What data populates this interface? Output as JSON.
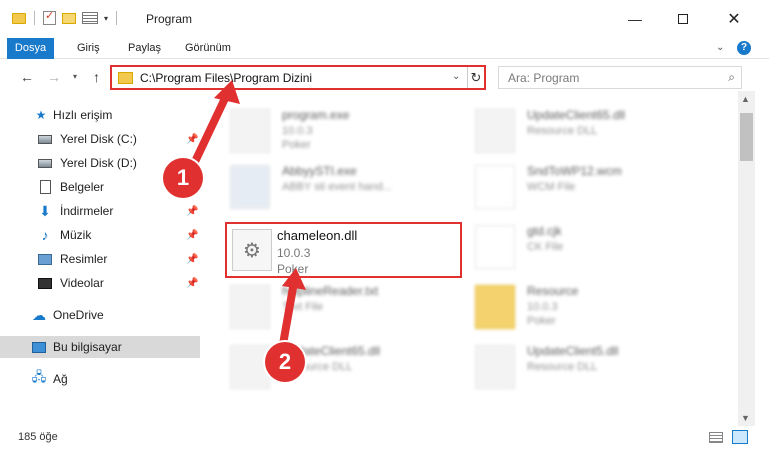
{
  "window": {
    "title": "Program",
    "minimize_glyph": "—",
    "close_glyph": "✕"
  },
  "ribbon": {
    "tabs": [
      {
        "label": "Dosya"
      },
      {
        "label": "Giriş"
      },
      {
        "label": "Paylaş"
      },
      {
        "label": "Görünüm"
      }
    ],
    "help_label": "?"
  },
  "navigation": {
    "address": "C:\\Program Files\\Program Dizini",
    "search_placeholder": "Ara: Program"
  },
  "sidebar": {
    "items": [
      {
        "label": "Hızlı erişim",
        "icon": "star-icon"
      },
      {
        "label": "Yerel Disk (C:)",
        "icon": "drive-icon",
        "pinned": true
      },
      {
        "label": "Yerel Disk (D:)",
        "icon": "drive-icon"
      },
      {
        "label": "Belgeler",
        "icon": "documents-icon",
        "pinned": true
      },
      {
        "label": "İndirmeler",
        "icon": "downloads-icon",
        "pinned": true
      },
      {
        "label": "Müzik",
        "icon": "music-icon",
        "pinned": true
      },
      {
        "label": "Resimler",
        "icon": "pictures-icon",
        "pinned": true
      },
      {
        "label": "Videolar",
        "icon": "videos-icon",
        "pinned": true
      },
      {
        "label": "OneDrive",
        "icon": "cloud-icon"
      },
      {
        "label": "Bu bilgisayar",
        "icon": "computer-icon",
        "selected": true
      },
      {
        "label": "Ağ",
        "icon": "network-icon"
      }
    ]
  },
  "files": {
    "left": [
      {
        "name": "program.exe",
        "line1": "10.0.3",
        "line2": "Poker"
      },
      {
        "name": "AbbyySTI.exe",
        "line1": "ABBY sti event hand...",
        "line2": ""
      },
      {
        "name": "chameleon.dll",
        "line1": "10.0.3",
        "line2": "Poker"
      },
      {
        "name": "helplineReader.txt",
        "line1": "Text File",
        "line2": ""
      },
      {
        "name": "UpdateClient65.dll",
        "line1": "Resource DLL",
        "line2": ""
      }
    ],
    "right": [
      {
        "name": "UpdateClient65.dll",
        "line1": "Resource DLL",
        "line2": ""
      },
      {
        "name": "SndToWP12.wcm",
        "line1": "WCM File",
        "line2": ""
      },
      {
        "name": "gtd.cjk",
        "line1": "CK File",
        "line2": ""
      },
      {
        "name": "Resource",
        "line1": "10.0.3",
        "line2": "Poker"
      },
      {
        "name": "UpdateClient5.dll",
        "line1": "Resource DLL",
        "line2": ""
      }
    ]
  },
  "status": {
    "item_count": "185 öğe"
  },
  "annotations": {
    "step1": "1",
    "step2": "2",
    "color": "#e03030"
  },
  "colors": {
    "accent": "#1979ca",
    "highlight_border": "#e03030"
  }
}
